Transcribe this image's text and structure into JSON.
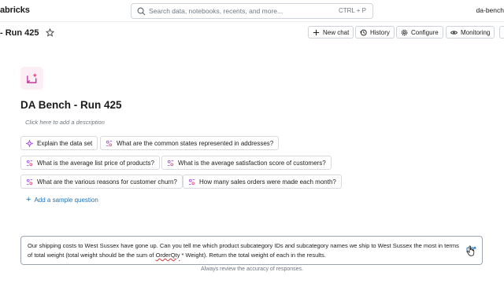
{
  "app": {
    "brand": "abricks",
    "workspace": "da-bench"
  },
  "search": {
    "placeholder": "Search data, notebooks, recents, and more...",
    "shortcut": "CTRL + P"
  },
  "header": {
    "title": "- Run 425",
    "actions": [
      {
        "label": "New chat",
        "icon": "plus-icon"
      },
      {
        "label": "History",
        "icon": "history-icon"
      },
      {
        "label": "Configure",
        "icon": "gear-icon"
      },
      {
        "label": "Monitoring",
        "icon": "eye-icon"
      }
    ]
  },
  "space": {
    "title": "DA Bench - Run 425",
    "description_placeholder": "Click here to add a description"
  },
  "sample_questions": [
    {
      "label": "Explain the data set",
      "icon": "sparkle-icon"
    },
    {
      "label": "What are the common states represented in addresses?",
      "icon": "genie-icon"
    },
    {
      "label": "What is the average list price of products?",
      "icon": "genie-icon"
    },
    {
      "label": "What is the average satisfaction score of customers?",
      "icon": "genie-icon"
    },
    {
      "label": "What are the various reasons for customer churn?",
      "icon": "genie-icon"
    },
    {
      "label": "How many sales orders were made each month?",
      "icon": "genie-icon"
    }
  ],
  "add_sample": "Add a sample question",
  "input": {
    "text_part1": "Our shipping costs to West Sussex have gone up. Can you tell me which product subcategory IDs and subcategory names we ship to West Sussex the most in terms of total weight (total weight should be the sum of ",
    "text_misspelled": "OrderQty",
    "text_part2": " * Weight). Return the total weight of each in the results."
  },
  "disclaimer": "Always review the accuracy of responses.",
  "colors": {
    "accent": "#2272b4",
    "genie_purple": "#9b3fd6",
    "genie_pink": "#e0457b"
  }
}
